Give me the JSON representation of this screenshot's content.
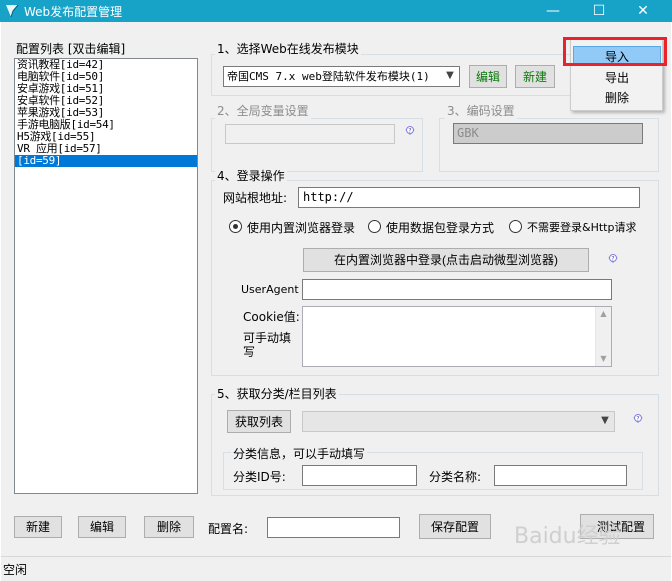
{
  "window": {
    "title": "Web发布配置管理",
    "minimize": "—",
    "maximize": "☐",
    "close": "✕"
  },
  "left": {
    "header": "配置列表  [双击编辑]",
    "items": [
      "资讯教程[id=42]",
      "电脑软件[id=50]",
      "安卓游戏[id=51]",
      "安卓软件[id=52]",
      "苹果游戏[id=53]",
      "手游电脑版[id=54]",
      "H5游戏[id=55]",
      "VR 应用[id=57]",
      "[id=59]"
    ],
    "selected_index": 8,
    "new_button": "新建",
    "edit_button": "编辑",
    "delete_button": "删除"
  },
  "section1": {
    "title": "1、选择Web在线发布模块",
    "module_value": "帝国CMS 7.x web登陆软件发布模块(1)",
    "edit_button": "编辑",
    "new_button": "新建"
  },
  "popup": {
    "items": [
      "导入",
      "导出",
      "删除"
    ],
    "highlighted_index": 0
  },
  "section2": {
    "title": "2、全局变量设置"
  },
  "section3": {
    "title": "3、编码设置",
    "encoding_value": "GBK"
  },
  "section4": {
    "title": "4、登录操作",
    "root_label": "网站根地址:",
    "root_value": "http://",
    "radio_builtin": "使用内置浏览器登录",
    "radio_packet": "使用数据包登录方式",
    "radio_none": "不需要登录&Http请求",
    "selected_radio": "builtin",
    "login_button": "在内置浏览器中登录(点击启动微型浏览器)",
    "ua_label": "UserAgent",
    "cookie_label": "Cookie值:",
    "manual_label": "可手动填写"
  },
  "section5": {
    "title": "5、获取分类/栏目列表",
    "fetch_button": "获取列表",
    "cat_info_title": "分类信息，可以手动填写",
    "cat_id_label": "分类ID号:",
    "cat_name_label": "分类名称:"
  },
  "bottom": {
    "config_name_label": "配置名:",
    "save_button": "保存配置",
    "test_button": "测试配置"
  },
  "status": {
    "text": "空闲"
  },
  "watermark": {
    "text": "Baidu经验"
  },
  "colors": {
    "titlebar": "#17a2c8",
    "selection": "#0078d7",
    "highlight_box": "#e8232b",
    "menu_hot": "#91c9f7"
  }
}
